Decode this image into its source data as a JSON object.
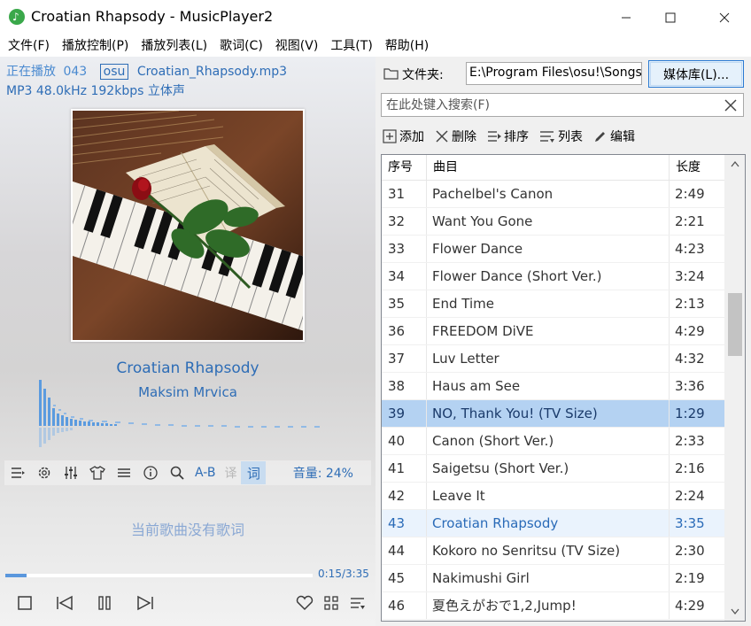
{
  "window": {
    "title": "Croatian Rhapsody - MusicPlayer2",
    "minimize_glyph": "—",
    "close_glyph": "✕"
  },
  "menu": [
    "文件(F)",
    "播放控制(P)",
    "播放列表(L)",
    "歌词(C)",
    "视图(V)",
    "工具(T)",
    "帮助(H)"
  ],
  "now_playing": {
    "label": "正在播放",
    "index": "043",
    "badge": "osu",
    "filename": "Croatian_Rhapsody.mp3",
    "format_info": "MP3 48.0kHz 192kbps 立体声",
    "title": "Croatian Rhapsody",
    "artist": "Maksim Mrvica",
    "no_lyrics": "当前歌曲没有歌词",
    "time": "0:15/3:35",
    "progress": 0.07
  },
  "controls": {
    "ab_label": "A-B",
    "translate_label": "译",
    "lyric_label": "词",
    "volume_label": "音量: 24%"
  },
  "folder": {
    "label": "文件夹:",
    "path": "E:\\Program Files\\osu!\\Songs",
    "library_button": "媒体库(L)..."
  },
  "search": {
    "placeholder": "在此处键入搜索(F)"
  },
  "toolbar": {
    "add": "添加",
    "delete": "删除",
    "sort": "排序",
    "list": "列表",
    "edit": "编辑"
  },
  "playlist": {
    "headers": {
      "index": "序号",
      "name": "曲目",
      "length": "长度"
    },
    "rows": [
      {
        "index": "31",
        "name": "Pachelbel's Canon",
        "length": "2:49",
        "state": ""
      },
      {
        "index": "32",
        "name": "Want You Gone",
        "length": "2:21",
        "state": ""
      },
      {
        "index": "33",
        "name": "Flower Dance",
        "length": "4:23",
        "state": ""
      },
      {
        "index": "34",
        "name": "Flower Dance (Short Ver.)",
        "length": "3:24",
        "state": ""
      },
      {
        "index": "35",
        "name": "End Time",
        "length": "2:13",
        "state": ""
      },
      {
        "index": "36",
        "name": "FREEDOM DiVE",
        "length": "4:29",
        "state": ""
      },
      {
        "index": "37",
        "name": "Luv Letter",
        "length": "4:32",
        "state": ""
      },
      {
        "index": "38",
        "name": "Haus am See",
        "length": "3:36",
        "state": ""
      },
      {
        "index": "39",
        "name": "NO, Thank You! (TV Size)",
        "length": "1:29",
        "state": "selected"
      },
      {
        "index": "40",
        "name": "Canon (Short Ver.)",
        "length": "2:33",
        "state": ""
      },
      {
        "index": "41",
        "name": "Saigetsu (Short Ver.)",
        "length": "2:16",
        "state": ""
      },
      {
        "index": "42",
        "name": "Leave It",
        "length": "2:24",
        "state": ""
      },
      {
        "index": "43",
        "name": "Croatian Rhapsody",
        "length": "3:35",
        "state": "playing"
      },
      {
        "index": "44",
        "name": "Kokoro no Senritsu (TV Size)",
        "length": "2:30",
        "state": ""
      },
      {
        "index": "45",
        "name": "Nakimushi Girl",
        "length": "2:19",
        "state": ""
      },
      {
        "index": "46",
        "name": "夏色えがおで1,2,Jump!",
        "length": "4:29",
        "state": ""
      }
    ]
  },
  "colors": {
    "accent": "#2e6db6",
    "selected_row": "#b4d2f2",
    "playing_row": "#eaf3fd"
  }
}
